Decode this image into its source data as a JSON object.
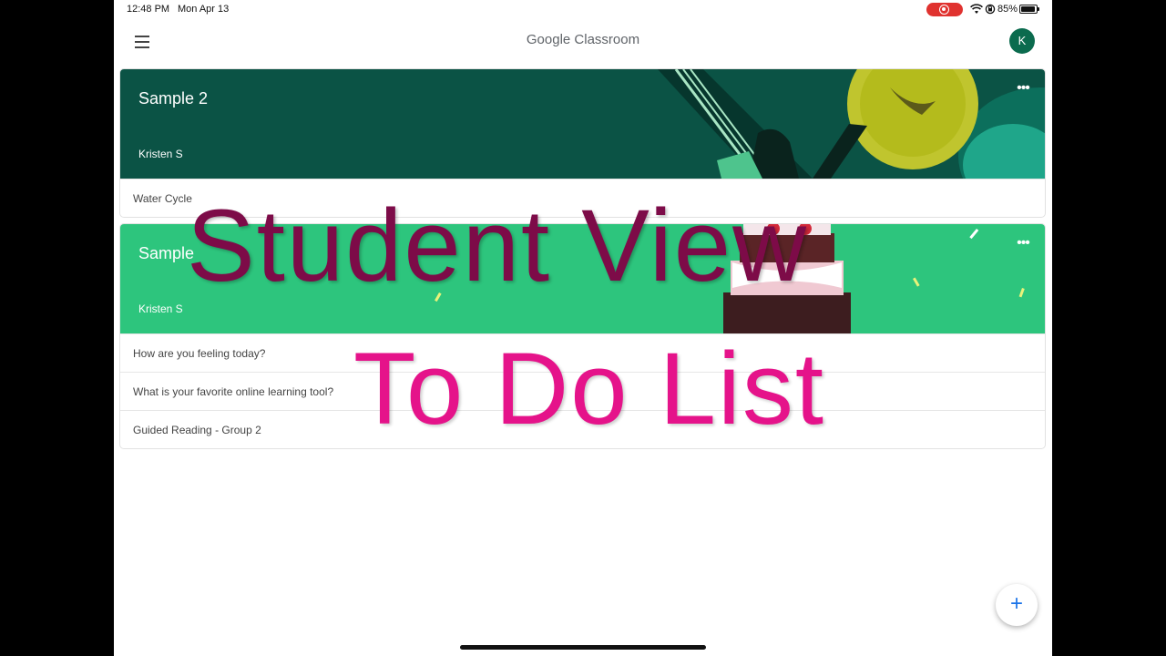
{
  "status_bar": {
    "time": "12:48 PM",
    "date": "Mon Apr 13",
    "battery": "85%"
  },
  "app_bar": {
    "title": "Google Classroom",
    "avatar_initial": "K"
  },
  "classes": [
    {
      "name": "Sample 2",
      "teacher": "Kristen S",
      "banner_color": "#0b5345",
      "todos": [
        "Water Cycle"
      ]
    },
    {
      "name": "Sample",
      "teacher": "Kristen S",
      "banner_color": "#2dc57d",
      "todos": [
        "How are you feeling today?",
        "What is your favorite online learning tool?",
        "Guided Reading - Group 2"
      ]
    }
  ],
  "overlay": {
    "title": "Student View",
    "subtitle": "To Do List",
    "title_color": "#7d0b48",
    "subtitle_color": "#e5138a"
  },
  "fab": {
    "icon": "plus-icon",
    "label": "+"
  }
}
